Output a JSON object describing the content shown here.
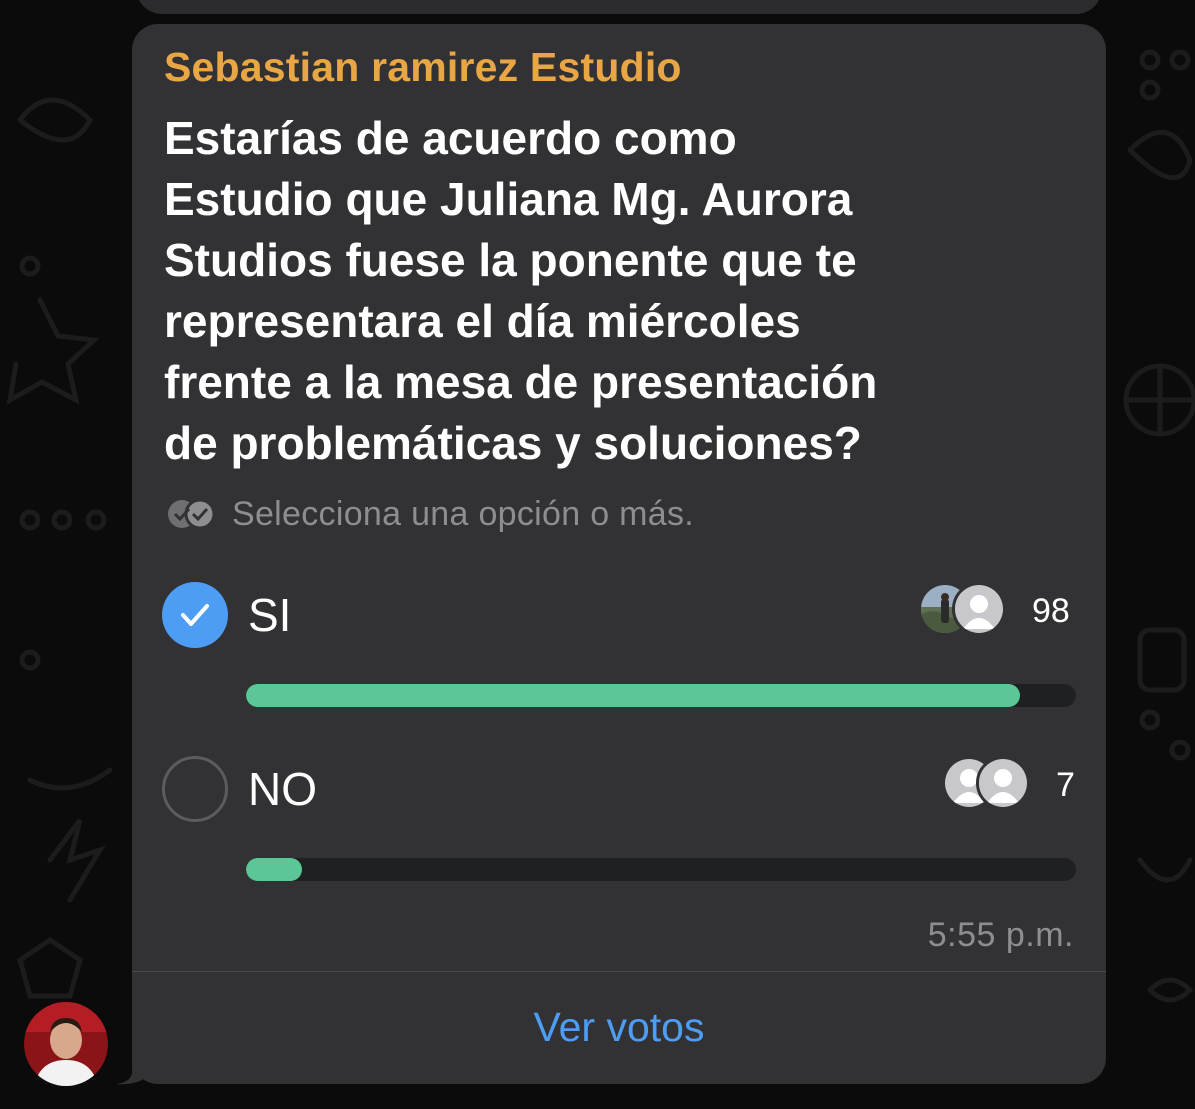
{
  "message": {
    "sender": "Sebastian ramirez Estudio",
    "time": "5:55 p.m."
  },
  "poll": {
    "question": "Estarías de acuerdo como\nEstudio que Juliana Mg. Aurora\nStudios fuese la ponente que te\nrepresentara el día miércoles\nfrente a la mesa de presentación\nde problemáticas y soluciones?",
    "hint": "Selecciona una opción o más.",
    "options": [
      {
        "label": "SI",
        "count": "98",
        "selected": true,
        "share": 0.933
      },
      {
        "label": "NO",
        "count": "7",
        "selected": false,
        "share": 0.067
      }
    ],
    "view_votes_label": "Ver votos"
  },
  "colors": {
    "sender_name": "#e9a645",
    "accent_blue": "#4e9df5",
    "progress_green": "#5cc796",
    "bubble_bg": "#323234"
  },
  "icons": {
    "hint": "double-check-icon",
    "selected": "check-icon",
    "voter_placeholder": "person-icon"
  }
}
